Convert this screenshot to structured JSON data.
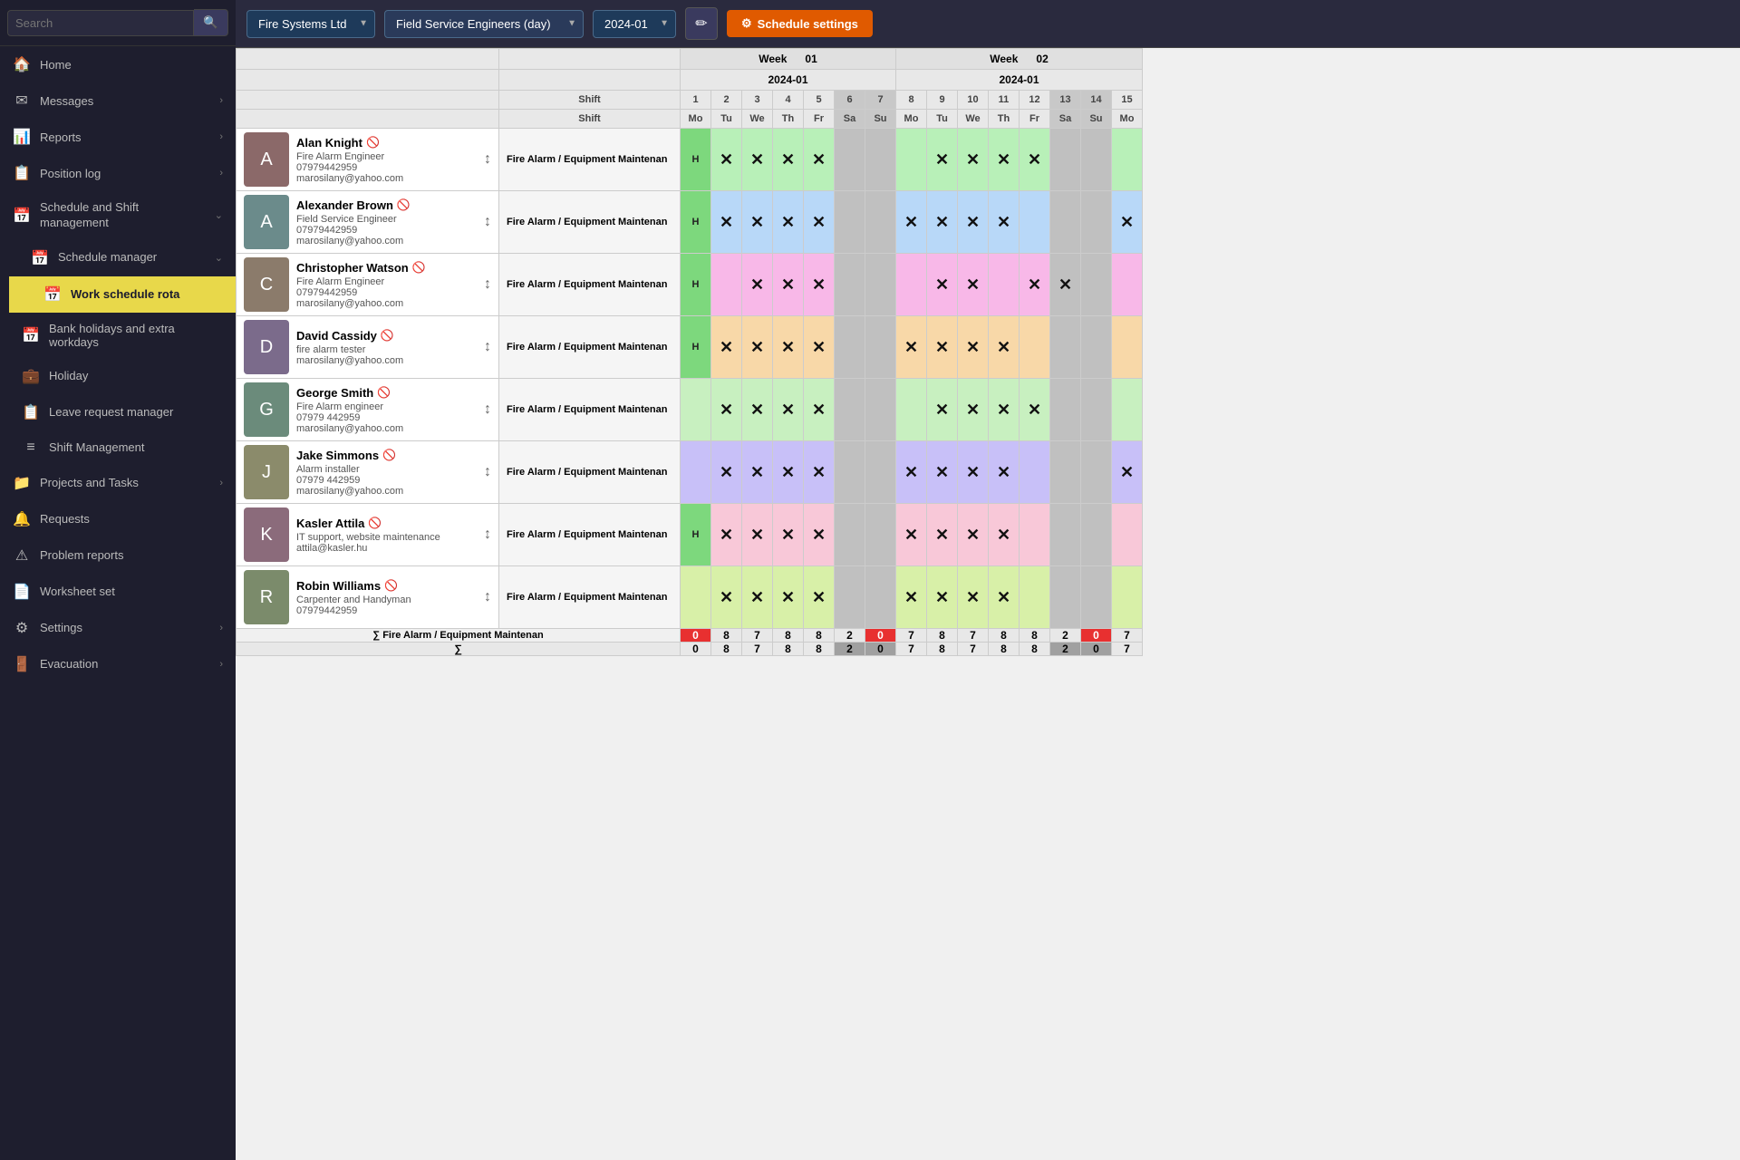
{
  "sidebar": {
    "search_placeholder": "Search",
    "items": [
      {
        "id": "home",
        "label": "Home",
        "icon": "🏠",
        "has_chevron": false
      },
      {
        "id": "messages",
        "label": "Messages",
        "icon": "✉",
        "has_chevron": true
      },
      {
        "id": "reports",
        "label": "Reports",
        "icon": "📊",
        "has_chevron": true
      },
      {
        "id": "position-log",
        "label": "Position log",
        "icon": "📋",
        "has_chevron": true
      },
      {
        "id": "schedule-shift",
        "label": "Schedule and Shift management",
        "icon": "📅",
        "has_chevron": true,
        "is_group": true
      },
      {
        "id": "schedule-manager",
        "label": "Schedule manager",
        "icon": "📅",
        "has_chevron": true,
        "indent": true
      },
      {
        "id": "work-schedule-rota",
        "label": "Work schedule rota",
        "icon": "📅",
        "active": true,
        "indent": true,
        "double_indent": true
      },
      {
        "id": "bank-holidays",
        "label": "Bank holidays and extra workdays",
        "icon": "📅",
        "indent": true
      },
      {
        "id": "holiday",
        "label": "Holiday",
        "icon": "💼",
        "indent": true
      },
      {
        "id": "leave-request",
        "label": "Leave request manager",
        "icon": "📋",
        "indent": true
      },
      {
        "id": "shift-management",
        "label": "Shift Management",
        "icon": "≡",
        "indent": true
      },
      {
        "id": "projects-tasks",
        "label": "Projects and Tasks",
        "icon": "📁",
        "has_chevron": true
      },
      {
        "id": "requests",
        "label": "Requests",
        "icon": "🔔",
        "has_chevron": false
      },
      {
        "id": "problem-reports",
        "label": "Problem reports",
        "icon": "⚠",
        "has_chevron": false
      },
      {
        "id": "worksheet-set",
        "label": "Worksheet set",
        "icon": "📄",
        "has_chevron": false
      },
      {
        "id": "settings",
        "label": "Settings",
        "icon": "⚙",
        "has_chevron": true
      },
      {
        "id": "evacuation",
        "label": "Evacuation",
        "icon": "🚪",
        "has_chevron": true
      }
    ]
  },
  "topbar": {
    "company": "Fire Systems Ltd",
    "team": "Field Service Engineers (day)",
    "period": "2024-01",
    "edit_icon": "✏",
    "settings_label": "Schedule settings",
    "settings_icon": "⚙"
  },
  "schedule": {
    "weeks": [
      {
        "label": "Week",
        "number": "01",
        "span": 7
      },
      {
        "label": "Week",
        "number": "02",
        "span": 7
      }
    ],
    "period_row": "2024-01",
    "days_week1": [
      "1",
      "2",
      "3",
      "4",
      "5",
      "6",
      "7"
    ],
    "days_week2": [
      "8",
      "9",
      "10",
      "11",
      "12",
      "13",
      "14",
      "15"
    ],
    "dow_week1": [
      "Mo",
      "Tu",
      "We",
      "Th",
      "Fr",
      "Sa",
      "Su"
    ],
    "dow_week2": [
      "Mo",
      "Tu",
      "We",
      "Th",
      "Fr",
      "Sa",
      "Su",
      "Mo"
    ],
    "shift_label": "Shift",
    "employees": [
      {
        "id": "alan-knight",
        "name": "Alan Knight",
        "role": "Fire Alarm Engineer",
        "phone": "07979442959",
        "email": "marosilany@yahoo.com",
        "shift": "Fire Alarm / Equipment Maintenan",
        "row_color": "row-green",
        "has_h_w1": true,
        "week1": [
          "H",
          "X",
          "X",
          "X",
          "X",
          "",
          ""
        ],
        "week2": [
          "",
          "X",
          "X",
          "X",
          "X",
          "",
          "",
          ""
        ]
      },
      {
        "id": "alexander-brown",
        "name": "Alexander Brown",
        "role": "Field Service Engineer",
        "phone": "07979442959",
        "email": "marosilany@yahoo.com",
        "shift": "Fire Alarm / Equipment Maintenan",
        "row_color": "row-blue",
        "has_h_w1": true,
        "week1": [
          "H",
          "X",
          "X",
          "X",
          "X",
          "",
          ""
        ],
        "week2": [
          "X",
          "X",
          "X",
          "X",
          "",
          "",
          "",
          "X"
        ]
      },
      {
        "id": "christopher-watson",
        "name": "Christopher Watson",
        "role": "Fire Alarm Engineer",
        "phone": "07979442959",
        "email": "marosilany@yahoo.com",
        "shift": "Fire Alarm / Equipment Maintenan",
        "row_color": "row-pink",
        "has_h_w1": true,
        "week1": [
          "H",
          "",
          "X",
          "X",
          "X",
          "",
          ""
        ],
        "week2": [
          "",
          "X",
          "X",
          "",
          "X",
          "X",
          "",
          ""
        ]
      },
      {
        "id": "david-cassidy",
        "name": "David Cassidy",
        "role": "fire alarm tester",
        "phone": "",
        "email": "marosilany@yahoo.com",
        "shift": "Fire Alarm / Equipment Maintenan",
        "row_color": "row-orange",
        "has_h_w1": true,
        "week1": [
          "H",
          "X",
          "X",
          "X",
          "X",
          "",
          ""
        ],
        "week2": [
          "X",
          "X",
          "X",
          "X",
          "",
          "",
          "",
          ""
        ]
      },
      {
        "id": "george-smith",
        "name": "George Smith",
        "role": "Fire Alarm engineer",
        "phone": "07979 442959",
        "email": "marosilany@yahoo.com",
        "shift": "Fire Alarm / Equipment Maintenan",
        "row_color": "row-green2",
        "has_h_w1": false,
        "week1": [
          "",
          "X",
          "X",
          "X",
          "X",
          "",
          ""
        ],
        "week2": [
          "",
          "X",
          "X",
          "X",
          "X",
          "",
          "",
          ""
        ]
      },
      {
        "id": "jake-simmons",
        "name": "Jake Simmons",
        "role": "Alarm installer",
        "phone": "07979 442959",
        "email": "marosilany@yahoo.com",
        "shift": "Fire Alarm / Equipment Maintenan",
        "row_color": "row-lavender",
        "has_h_w1": false,
        "week1": [
          "",
          "X",
          "X",
          "X",
          "X",
          "",
          ""
        ],
        "week2": [
          "X",
          "X",
          "X",
          "X",
          "",
          "",
          "",
          "X"
        ]
      },
      {
        "id": "kasler-attila",
        "name": "Kasler Attila",
        "role": "IT support, website maintenance",
        "phone": "",
        "email": "attila@kasler.hu",
        "shift": "Fire Alarm / Equipment Maintenan",
        "row_color": "row-pink2",
        "has_h_w1": true,
        "week1": [
          "H",
          "X",
          "X",
          "X",
          "X",
          "",
          ""
        ],
        "week2": [
          "X",
          "X",
          "X",
          "X",
          "",
          "",
          "",
          ""
        ]
      },
      {
        "id": "robin-williams",
        "name": "Robin Williams",
        "role": "Carpenter and Handyman",
        "phone": "07979442959",
        "email": "",
        "shift": "Fire Alarm / Equipment Maintenan",
        "row_color": "row-lime",
        "has_h_w1": false,
        "week1": [
          "",
          "X",
          "X",
          "X",
          "X",
          "",
          ""
        ],
        "week2": [
          "X",
          "X",
          "X",
          "X",
          "",
          "",
          "",
          ""
        ]
      }
    ],
    "summary_label": "∑ Fire Alarm / Equipment Maintenan",
    "summary_week1": [
      "0",
      "8",
      "7",
      "8",
      "8",
      "2",
      "0"
    ],
    "summary_week2": [
      "7",
      "8",
      "7",
      "8",
      "8",
      "2",
      "0",
      "7"
    ],
    "total_label": "∑",
    "total_week1": [
      "0",
      "8",
      "7",
      "8",
      "8",
      "2",
      "0"
    ],
    "total_week2": [
      "7",
      "8",
      "7",
      "8",
      "8",
      "2",
      "0",
      "7"
    ]
  }
}
